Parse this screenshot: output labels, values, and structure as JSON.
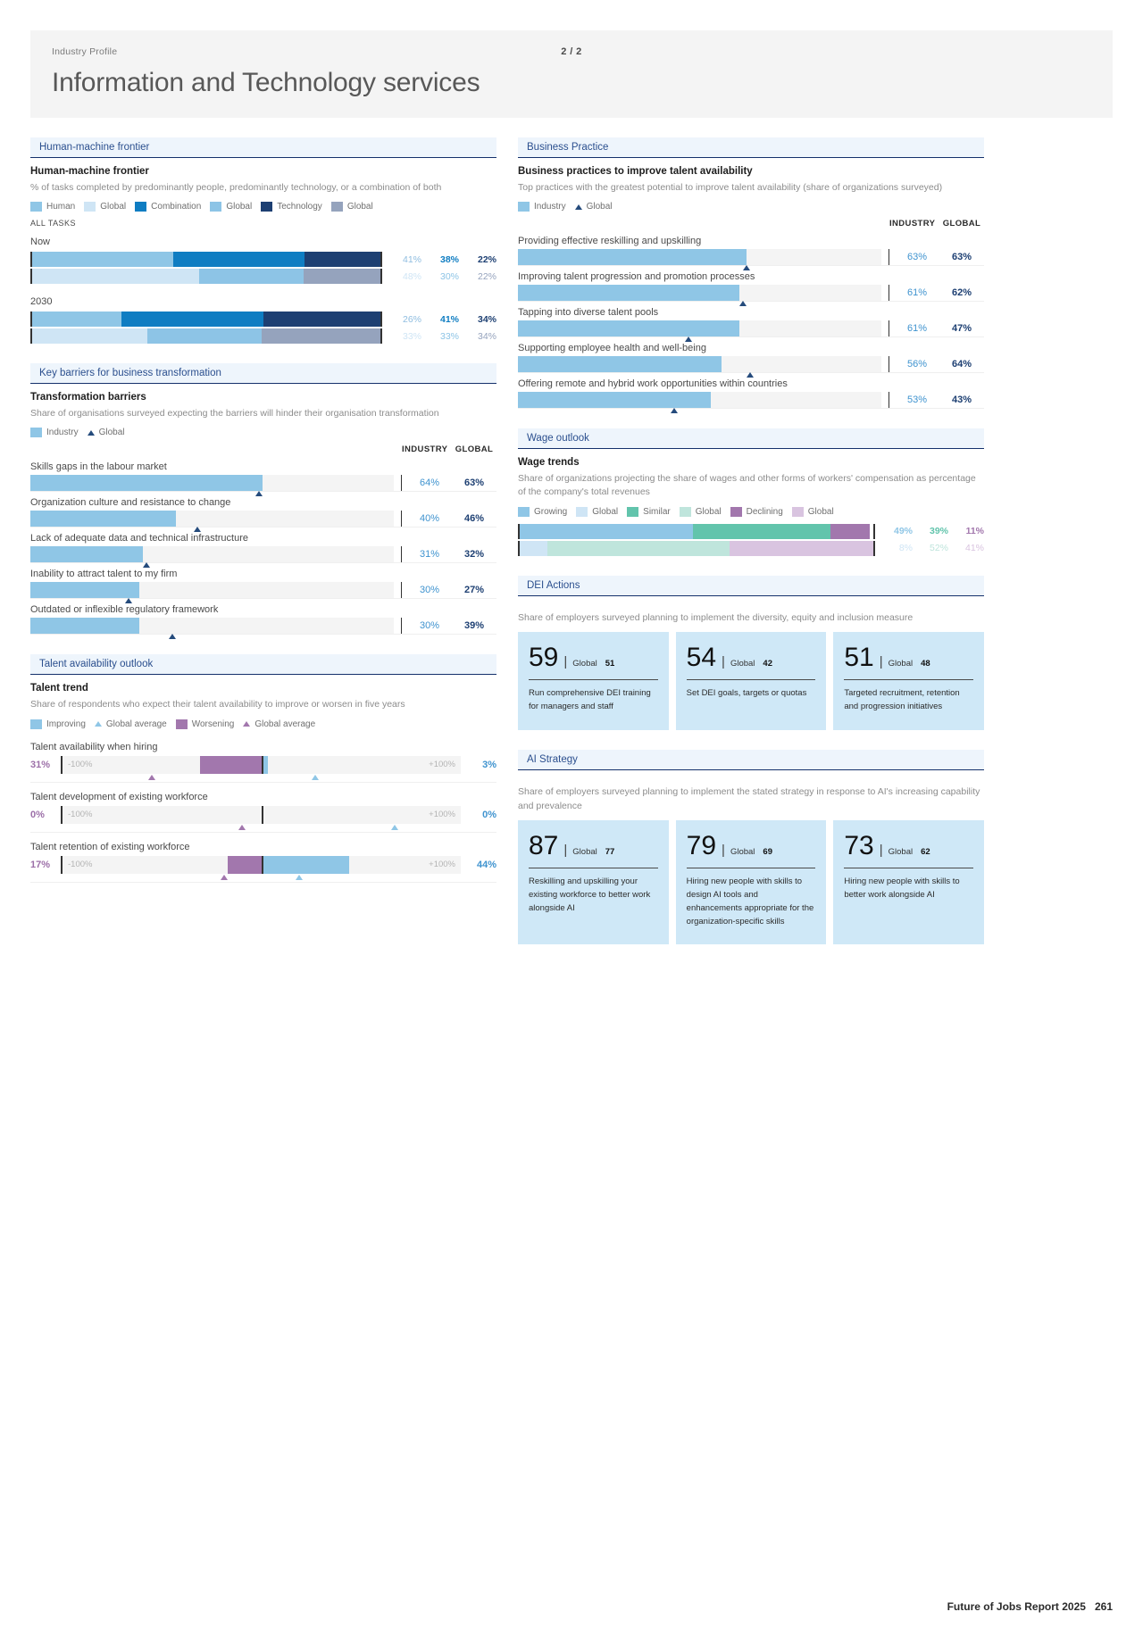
{
  "header": {
    "kicker": "Industry Profile",
    "page_indicator": "2 / 2",
    "title": "Information and Technology services"
  },
  "human_machine_frontier": {
    "tab": "Human-machine frontier",
    "title": "Human-machine frontier",
    "subtitle": "% of tasks completed by predominantly people, predominantly technology, or a combination of both",
    "legend": [
      {
        "label": "Human",
        "color": "#8fc6e6"
      },
      {
        "label": "Global",
        "color": "#cfe5f5"
      },
      {
        "label": "Combination",
        "color": "#0f7dc2"
      },
      {
        "label": "Global",
        "color": "#8dc4e6"
      },
      {
        "label": "Technology",
        "color": "#1d3f72"
      },
      {
        "label": "Global",
        "color": "#95a3bd"
      }
    ],
    "section_label": "ALL TASKS",
    "groups": [
      {
        "label": "Now",
        "industry": {
          "human": 41,
          "combination": 38,
          "technology": 22
        },
        "global": {
          "human": 48,
          "combination": 30,
          "technology": 22
        }
      },
      {
        "label": "2030",
        "industry": {
          "human": 26,
          "combination": 41,
          "technology": 34
        },
        "global": {
          "human": 33,
          "combination": 33,
          "technology": 34
        }
      }
    ]
  },
  "business_practice": {
    "tab": "Business Practice",
    "title": "Business practices to improve talent availability",
    "subtitle": "Top practices with the greatest potential to improve talent availability (share of organizations surveyed)",
    "legend": [
      {
        "label": "Industry",
        "color": "#8fc6e6",
        "type": "swatch"
      },
      {
        "label": "Global",
        "color": "#254b7c",
        "type": "triangle"
      }
    ],
    "col_industry": "INDUSTRY",
    "col_global": "GLOBAL",
    "rows": [
      {
        "label": "Providing effective reskilling and upskilling",
        "industry": 63,
        "global": 63,
        "industry_label": "63%",
        "global_label": "63%"
      },
      {
        "label": "Improving talent progression and promotion processes",
        "industry": 61,
        "global": 62,
        "industry_label": "61%",
        "global_label": "62%"
      },
      {
        "label": "Tapping into diverse talent pools",
        "industry": 61,
        "global": 47,
        "industry_label": "61%",
        "global_label": "47%"
      },
      {
        "label": "Supporting employee health and well-being",
        "industry": 56,
        "global": 64,
        "industry_label": "56%",
        "global_label": "64%"
      },
      {
        "label": "Offering remote and hybrid work opportunities within countries",
        "industry": 53,
        "global": 43,
        "industry_label": "53%",
        "global_label": "43%"
      }
    ]
  },
  "key_barriers": {
    "tab": "Key barriers for business transformation",
    "title": "Transformation barriers",
    "subtitle": "Share of organisations surveyed expecting the barriers will hinder their organisation transformation",
    "legend": [
      {
        "label": "Industry",
        "color": "#8fc6e6",
        "type": "swatch"
      },
      {
        "label": "Global",
        "color": "#254b7c",
        "type": "triangle"
      }
    ],
    "col_industry": "INDUSTRY",
    "col_global": "GLOBAL",
    "rows": [
      {
        "label": "Skills gaps in the labour market",
        "industry": 64,
        "global": 63,
        "industry_label": "64%",
        "global_label": "63%"
      },
      {
        "label": "Organization culture and resistance to change",
        "industry": 40,
        "global": 46,
        "industry_label": "40%",
        "global_label": "46%"
      },
      {
        "label": "Lack of adequate data and technical infrastructure",
        "industry": 31,
        "global": 32,
        "industry_label": "31%",
        "global_label": "32%"
      },
      {
        "label": "Inability to attract talent to my firm",
        "industry": 30,
        "global": 27,
        "industry_label": "30%",
        "global_label": "27%"
      },
      {
        "label": "Outdated or inflexible regulatory framework",
        "industry": 30,
        "global": 39,
        "industry_label": "30%",
        "global_label": "39%"
      }
    ]
  },
  "wage_outlook": {
    "tab": "Wage outlook",
    "title": "Wage trends",
    "subtitle": "Share of organizations projecting the share of wages and other forms of workers' compensation as percentage of the company's total revenues",
    "legend": [
      {
        "label": "Growing",
        "color": "#8fc6e6"
      },
      {
        "label": "Global",
        "color": "#cfe5f5"
      },
      {
        "label": "Similar",
        "color": "#62c4ac"
      },
      {
        "label": "Global",
        "color": "#bfe5dc"
      },
      {
        "label": "Declining",
        "color": "#a277ad"
      },
      {
        "label": "Global",
        "color": "#d9c4e0"
      }
    ],
    "industry": {
      "growing": 49,
      "similar": 39,
      "declining": 11,
      "growing_label": "49%",
      "similar_label": "39%",
      "declining_label": "11%"
    },
    "global": {
      "growing": 8,
      "similar": 52,
      "declining": 41,
      "growing_label": "8%",
      "similar_label": "52%",
      "declining_label": "41%"
    }
  },
  "talent_outlook": {
    "tab": "Talent availability outlook",
    "title": "Talent trend",
    "subtitle": "Share of respondents who expect their talent availability to improve or worsen in five years",
    "legend": [
      {
        "label": "Improving",
        "color": "#8fc6e6",
        "type": "swatch"
      },
      {
        "label": "Global average",
        "color": "#8fc6e6",
        "type": "triangle"
      },
      {
        "label": "Worsening",
        "color": "#a277ad",
        "type": "swatch"
      },
      {
        "label": "Global average",
        "color": "#a277ad",
        "type": "triangle"
      }
    ],
    "axis_min": "-100%",
    "axis_max": "+100%",
    "rows": [
      {
        "label": "Talent availability when hiring",
        "left_value": "31%",
        "right_value": "3%",
        "neg": 31,
        "pos": 3,
        "marker_neg": -55,
        "marker_pos": 27
      },
      {
        "label": "Talent development of existing workforce",
        "left_value": "0%",
        "right_value": "0%",
        "neg": 0,
        "pos": 0,
        "marker_neg": -10,
        "marker_pos": 67
      },
      {
        "label": "Talent retention of existing workforce",
        "left_value": "17%",
        "right_value": "44%",
        "neg": 17,
        "pos": 44,
        "marker_neg": -19,
        "marker_pos": 19
      }
    ]
  },
  "dei_actions": {
    "tab": "DEI Actions",
    "subtitle": "Share of employers surveyed planning to implement the diversity, equity and inclusion measure",
    "global_label": "Global",
    "cards": [
      {
        "value": "59",
        "global": "51",
        "desc": "Run comprehensive DEI training for managers and staff"
      },
      {
        "value": "54",
        "global": "42",
        "desc": "Set DEI goals, targets or quotas"
      },
      {
        "value": "51",
        "global": "48",
        "desc": "Targeted recruitment, retention and progression initiatives"
      }
    ]
  },
  "ai_strategy": {
    "tab": "AI Strategy",
    "subtitle": "Share of employers surveyed planning to implement the stated strategy in response to AI's increasing capability and prevalence",
    "global_label": "Global",
    "cards": [
      {
        "value": "87",
        "global": "77",
        "desc": "Reskilling and upskilling your existing workforce to better work alongside AI"
      },
      {
        "value": "79",
        "global": "69",
        "desc": "Hiring new people with skills to design AI tools and enhancements appropriate for the organization-specific skills"
      },
      {
        "value": "73",
        "global": "62",
        "desc": "Hiring new people with skills to better work alongside AI"
      }
    ]
  },
  "footer": {
    "report": "Future of Jobs Report 2025",
    "page": "261"
  },
  "chart_data": [
    {
      "type": "bar",
      "title": "Human-machine frontier",
      "subtitle": "% of tasks completed by predominantly people, predominantly technology, or a combination of both",
      "stacked": true,
      "categories": [
        "Now - Industry",
        "Now - Global",
        "2030 - Industry",
        "2030 - Global"
      ],
      "series": [
        {
          "name": "Human",
          "values": [
            41,
            48,
            26,
            33
          ]
        },
        {
          "name": "Combination",
          "values": [
            38,
            30,
            41,
            33
          ]
        },
        {
          "name": "Technology",
          "values": [
            22,
            22,
            34,
            34
          ]
        }
      ],
      "ylim": [
        0,
        100
      ],
      "legend": "top"
    },
    {
      "type": "bar",
      "title": "Business practices to improve talent availability",
      "categories": [
        "Providing effective reskilling and upskilling",
        "Improving talent progression and promotion processes",
        "Tapping into diverse talent pools",
        "Supporting employee health and well-being",
        "Offering remote and hybrid work opportunities within countries"
      ],
      "series": [
        {
          "name": "INDUSTRY",
          "values": [
            63,
            61,
            61,
            56,
            53
          ]
        },
        {
          "name": "GLOBAL",
          "values": [
            63,
            62,
            47,
            64,
            43
          ]
        }
      ],
      "xlabel": "%",
      "ylabel": "",
      "ylim": [
        0,
        100
      ]
    },
    {
      "type": "bar",
      "title": "Transformation barriers",
      "categories": [
        "Skills gaps in the labour market",
        "Organization culture and resistance to change",
        "Lack of adequate data and technical infrastructure",
        "Inability to attract talent to my firm",
        "Outdated or inflexible regulatory framework"
      ],
      "series": [
        {
          "name": "INDUSTRY",
          "values": [
            64,
            40,
            31,
            30,
            30
          ]
        },
        {
          "name": "GLOBAL",
          "values": [
            63,
            46,
            32,
            27,
            39
          ]
        }
      ],
      "xlabel": "%",
      "ylabel": "",
      "ylim": [
        0,
        100
      ]
    },
    {
      "type": "bar",
      "title": "Wage trends",
      "stacked": true,
      "categories": [
        "Industry",
        "Global"
      ],
      "series": [
        {
          "name": "Growing",
          "values": [
            49,
            8
          ]
        },
        {
          "name": "Similar",
          "values": [
            39,
            52
          ]
        },
        {
          "name": "Declining",
          "values": [
            11,
            41
          ]
        }
      ],
      "ylim": [
        0,
        100
      ]
    },
    {
      "type": "bar",
      "title": "Talent trend",
      "categories": [
        "Talent availability when hiring",
        "Talent development of existing workforce",
        "Talent retention of existing workforce"
      ],
      "series": [
        {
          "name": "Worsening",
          "values": [
            31,
            0,
            17
          ]
        },
        {
          "name": "Improving",
          "values": [
            3,
            0,
            44
          ]
        }
      ],
      "xlim": [
        -100,
        100
      ]
    }
  ]
}
